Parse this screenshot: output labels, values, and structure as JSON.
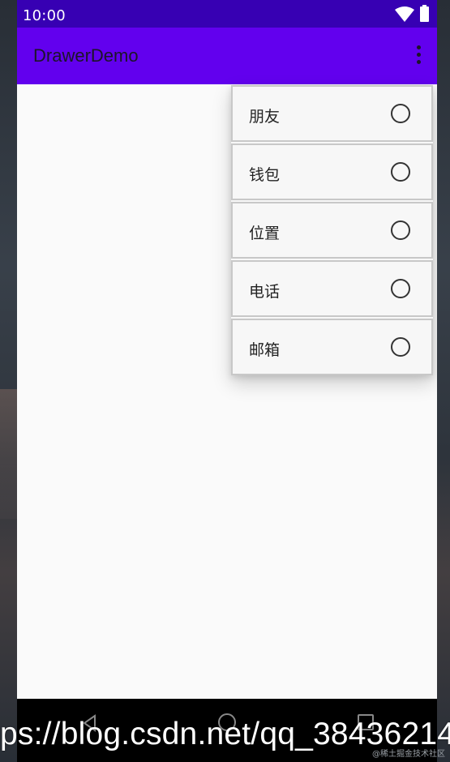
{
  "status_bar": {
    "time": "10:00",
    "icons": [
      "wifi-icon",
      "battery-icon"
    ],
    "color": "#3700b3"
  },
  "app_bar": {
    "title": "DrawerDemo",
    "overflow_icon": "more-vert-icon",
    "color": "#6200ee"
  },
  "menu": {
    "items": [
      {
        "label": "朋友",
        "checked": false
      },
      {
        "label": "钱包",
        "checked": false
      },
      {
        "label": "位置",
        "checked": false
      },
      {
        "label": "电话",
        "checked": false
      },
      {
        "label": "邮箱",
        "checked": false
      }
    ]
  },
  "nav_bar": {
    "icons": [
      "back-icon",
      "home-icon",
      "recents-icon"
    ]
  },
  "watermark": {
    "text": "ps://blog.csdn.net/qq_38436214",
    "small_text": "@稀土掘金技术社区"
  }
}
